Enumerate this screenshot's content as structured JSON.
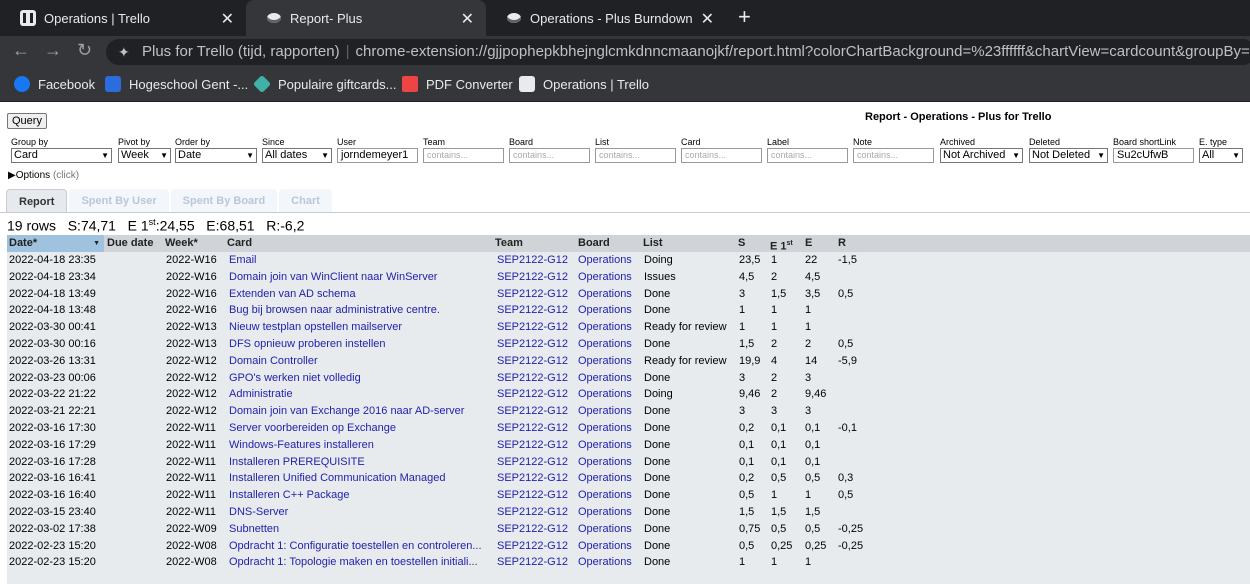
{
  "browser": {
    "tabs": [
      {
        "title": "Operations | Trello",
        "icon": "trello-icon",
        "active": false
      },
      {
        "title": "Report- Plus",
        "icon": "plus-icon",
        "active": true
      },
      {
        "title": "Operations - Plus Burndown",
        "icon": "plus-icon",
        "active": false
      }
    ],
    "new_tab": "+",
    "extension_name": "Plus for Trello (tijd, rapporten)",
    "url": "chrome-extension://gjjpophepkbhejnglcmkdnncmaanojkf/report.html?colorChartBackground=%23ffffff&chartView=cardcount&groupBy=idCardH",
    "bookmarks": [
      {
        "label": "Facebook",
        "icon": "facebook-icon"
      },
      {
        "label": "Hogeschool Gent -...",
        "icon": "hogent-icon"
      },
      {
        "label": "Populaire giftcards...",
        "icon": "giftcard-icon"
      },
      {
        "label": "PDF Converter",
        "icon": "pdf-icon"
      },
      {
        "label": "Operations | Trello",
        "icon": "trello-icon"
      }
    ]
  },
  "report": {
    "query_label": "Query",
    "title": "Report - Operations - Plus for Trello",
    "filters": {
      "group_by": {
        "label": "Group by",
        "value": "Card"
      },
      "pivot_by": {
        "label": "Pivot by",
        "value": "Week"
      },
      "order_by": {
        "label": "Order by",
        "value": "Date"
      },
      "since": {
        "label": "Since",
        "value": "All dates"
      },
      "user": {
        "label": "User",
        "value": "jorndemeyer1"
      },
      "team": {
        "label": "Team",
        "placeholder": "contains..."
      },
      "board": {
        "label": "Board",
        "placeholder": "contains..."
      },
      "list": {
        "label": "List",
        "placeholder": "contains..."
      },
      "card": {
        "label": "Card",
        "placeholder": "contains..."
      },
      "label": {
        "label": "Label",
        "placeholder": "contains..."
      },
      "note": {
        "label": "Note",
        "placeholder": "contains..."
      },
      "archived": {
        "label": "Archived",
        "value": "Not Archived"
      },
      "deleted": {
        "label": "Deleted",
        "value": "Not Deleted"
      },
      "board_shortlink": {
        "label": "Board shortLink",
        "value": "Su2cUfwB"
      },
      "e_type": {
        "label": "E. type",
        "value": "All"
      }
    },
    "options_label": "Options",
    "options_hint": "(click)",
    "tabs": [
      "Report",
      "Spent By User",
      "Spent By Board",
      "Chart"
    ],
    "summary": {
      "rows": "19 rows",
      "s_label": "S:",
      "s_value": "74,71",
      "e1_label": "E 1",
      "e1_sup": "st",
      "e1_value": ":24,55",
      "e_label": "E:",
      "e_value": "68,51",
      "r_label": "R:",
      "r_value": "-6,2"
    },
    "columns": {
      "date": "Date*",
      "due": "Due date",
      "week": "Week*",
      "card": "Card",
      "team": "Team",
      "board": "Board",
      "list": "List",
      "s": "S",
      "e1": "E 1",
      "e1_sup": "st",
      "e": "E",
      "r": "R"
    },
    "rows": [
      {
        "date": "2022-04-18 23:35",
        "due": "",
        "week": "2022-W16",
        "card": "Email",
        "team": "SEP2122-G12",
        "board": "Operations",
        "list": "Doing",
        "s": "23,5",
        "e1": "1",
        "e": "22",
        "r": "-1,5"
      },
      {
        "date": "2022-04-18 23:34",
        "due": "",
        "week": "2022-W16",
        "card": "Domain join van WinClient naar WinServer",
        "team": "SEP2122-G12",
        "board": "Operations",
        "list": "Issues",
        "s": "4,5",
        "e1": "2",
        "e": "4,5",
        "r": ""
      },
      {
        "date": "2022-04-18 13:49",
        "due": "",
        "week": "2022-W16",
        "card": "Extenden van AD schema",
        "team": "SEP2122-G12",
        "board": "Operations",
        "list": "Done",
        "s": "3",
        "e1": "1,5",
        "e": "3,5",
        "r": "0,5"
      },
      {
        "date": "2022-04-18 13:48",
        "due": "",
        "week": "2022-W16",
        "card": "Bug bij browsen naar administrative centre.",
        "team": "SEP2122-G12",
        "board": "Operations",
        "list": "Done",
        "s": "1",
        "e1": "1",
        "e": "1",
        "r": ""
      },
      {
        "date": "2022-03-30 00:41",
        "due": "",
        "week": "2022-W13",
        "card": "Nieuw testplan opstellen mailserver",
        "team": "SEP2122-G12",
        "board": "Operations",
        "list": "Ready for review",
        "s": "1",
        "e1": "1",
        "e": "1",
        "r": ""
      },
      {
        "date": "2022-03-30 00:16",
        "due": "",
        "week": "2022-W13",
        "card": "DFS opnieuw proberen instellen",
        "team": "SEP2122-G12",
        "board": "Operations",
        "list": "Done",
        "s": "1,5",
        "e1": "2",
        "e": "2",
        "r": "0,5"
      },
      {
        "date": "2022-03-26 13:31",
        "due": "",
        "week": "2022-W12",
        "card": "Domain Controller",
        "team": "SEP2122-G12",
        "board": "Operations",
        "list": "Ready for review",
        "s": "19,9",
        "e1": "4",
        "e": "14",
        "r": "-5,9"
      },
      {
        "date": "2022-03-23 00:06",
        "due": "",
        "week": "2022-W12",
        "card": "GPO's werken niet volledig",
        "team": "SEP2122-G12",
        "board": "Operations",
        "list": "Done",
        "s": "3",
        "e1": "2",
        "e": "3",
        "r": ""
      },
      {
        "date": "2022-03-22 21:22",
        "due": "",
        "week": "2022-W12",
        "card": "Administratie",
        "team": "SEP2122-G12",
        "board": "Operations",
        "list": "Doing",
        "s": "9,46",
        "e1": "2",
        "e": "9,46",
        "r": ""
      },
      {
        "date": "2022-03-21 22:21",
        "due": "",
        "week": "2022-W12",
        "card": "Domain join van Exchange 2016 naar AD-server",
        "team": "SEP2122-G12",
        "board": "Operations",
        "list": "Done",
        "s": "3",
        "e1": "3",
        "e": "3",
        "r": ""
      },
      {
        "date": "2022-03-16 17:30",
        "due": "",
        "week": "2022-W11",
        "card": "Server voorbereiden op Exchange",
        "team": "SEP2122-G12",
        "board": "Operations",
        "list": "Done",
        "s": "0,2",
        "e1": "0,1",
        "e": "0,1",
        "r": "-0,1"
      },
      {
        "date": "2022-03-16 17:29",
        "due": "",
        "week": "2022-W11",
        "card": "Windows-Features installeren",
        "team": "SEP2122-G12",
        "board": "Operations",
        "list": "Done",
        "s": "0,1",
        "e1": "0,1",
        "e": "0,1",
        "r": ""
      },
      {
        "date": "2022-03-16 17:28",
        "due": "",
        "week": "2022-W11",
        "card": "Installeren PREREQUISITE",
        "team": "SEP2122-G12",
        "board": "Operations",
        "list": "Done",
        "s": "0,1",
        "e1": "0,1",
        "e": "0,1",
        "r": ""
      },
      {
        "date": "2022-03-16 16:41",
        "due": "",
        "week": "2022-W11",
        "card": "Installeren Unified Communication Managed",
        "team": "SEP2122-G12",
        "board": "Operations",
        "list": "Done",
        "s": "0,2",
        "e1": "0,5",
        "e": "0,5",
        "r": "0,3"
      },
      {
        "date": "2022-03-16 16:40",
        "due": "",
        "week": "2022-W11",
        "card": "Installeren C++ Package",
        "team": "SEP2122-G12",
        "board": "Operations",
        "list": "Done",
        "s": "0,5",
        "e1": "1",
        "e": "1",
        "r": "0,5"
      },
      {
        "date": "2022-03-15 23:40",
        "due": "",
        "week": "2022-W11",
        "card": "DNS-Server",
        "team": "SEP2122-G12",
        "board": "Operations",
        "list": "Done",
        "s": "1,5",
        "e1": "1,5",
        "e": "1,5",
        "r": ""
      },
      {
        "date": "2022-03-02 17:38",
        "due": "",
        "week": "2022-W09",
        "card": "Subnetten",
        "team": "SEP2122-G12",
        "board": "Operations",
        "list": "Done",
        "s": "0,75",
        "e1": "0,5",
        "e": "0,5",
        "r": "-0,25"
      },
      {
        "date": "2022-02-23 15:20",
        "due": "",
        "week": "2022-W08",
        "card": "Opdracht 1: Configuratie toestellen en controleren...",
        "team": "SEP2122-G12",
        "board": "Operations",
        "list": "Done",
        "s": "0,5",
        "e1": "0,25",
        "e": "0,25",
        "r": "-0,25"
      },
      {
        "date": "2022-02-23 15:20",
        "due": "",
        "week": "2022-W08",
        "card": "Opdracht 1: Topologie maken en toestellen initiali...",
        "team": "SEP2122-G12",
        "board": "Operations",
        "list": "Done",
        "s": "1",
        "e1": "1",
        "e": "1",
        "r": ""
      }
    ]
  }
}
